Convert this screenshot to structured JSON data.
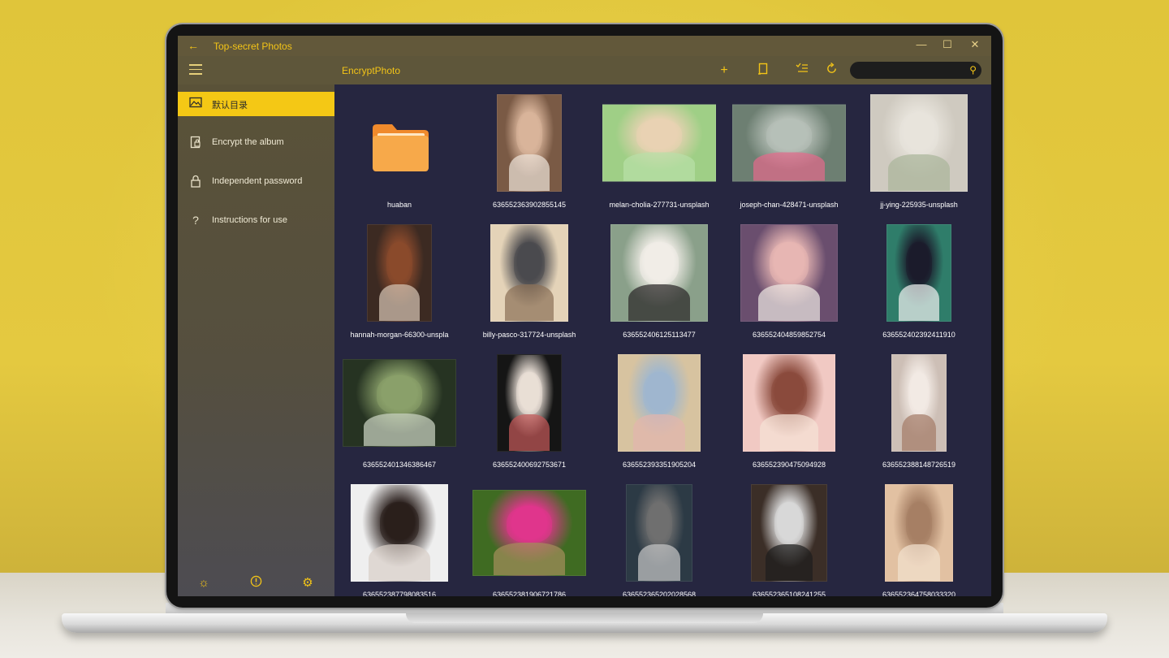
{
  "window": {
    "title": "Top-secret Photos",
    "controls": {
      "minimize": "—",
      "maximize": "☐",
      "close": "✕"
    }
  },
  "toolbar": {
    "page_title": "EncryptPhoto",
    "search_placeholder": ""
  },
  "sidebar": {
    "items": [
      {
        "label": "默认目录",
        "icon": "image-icon",
        "active": true
      },
      {
        "label": "Encrypt the album",
        "icon": "lock-file-icon",
        "active": false
      },
      {
        "label": "Independent password",
        "icon": "lock-icon",
        "active": false
      },
      {
        "label": "Instructions for use",
        "icon": "help-icon",
        "active": false
      }
    ],
    "bottom_icons": [
      "brightness-icon",
      "info-icon",
      "settings-icon"
    ]
  },
  "colors": {
    "accent": "#f4c815",
    "content_bg": "#262640",
    "sidebar_bg": "#5a5238"
  },
  "items": [
    {
      "name": "huaban",
      "kind": "folder"
    },
    {
      "name": "636552363902855145",
      "kind": "photo"
    },
    {
      "name": "melan-cholia-277731-unsplash",
      "kind": "photo"
    },
    {
      "name": "joseph-chan-428471-unsplash",
      "kind": "photo"
    },
    {
      "name": "jj-ying-225935-unsplash",
      "kind": "photo"
    },
    {
      "name": "hannah-morgan-66300-unspla",
      "kind": "photo"
    },
    {
      "name": "billy-pasco-317724-unsplash",
      "kind": "photo"
    },
    {
      "name": "636552406125113477",
      "kind": "photo"
    },
    {
      "name": "636552404859852754",
      "kind": "photo"
    },
    {
      "name": "636552402392411910",
      "kind": "photo"
    },
    {
      "name": "636552401346386467",
      "kind": "photo"
    },
    {
      "name": "636552400692753671",
      "kind": "photo"
    },
    {
      "name": "636552393351905204",
      "kind": "photo"
    },
    {
      "name": "636552390475094928",
      "kind": "photo"
    },
    {
      "name": "636552388148726519",
      "kind": "photo"
    },
    {
      "name": "636552387798083516",
      "kind": "photo"
    },
    {
      "name": "636552381906721786",
      "kind": "photo"
    },
    {
      "name": "636552365202028568",
      "kind": "photo"
    },
    {
      "name": "636552365108241255",
      "kind": "photo"
    },
    {
      "name": "636552364758033320",
      "kind": "photo"
    }
  ]
}
